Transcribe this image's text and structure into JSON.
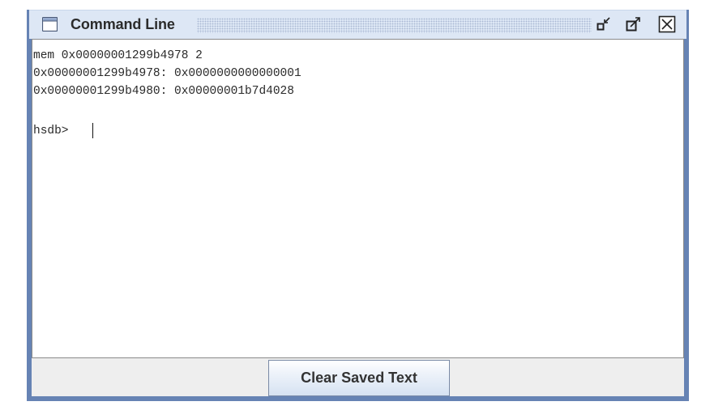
{
  "window": {
    "title": "Command Line",
    "icons": {
      "window": "terminal-window-icon",
      "iconify": "iconify-icon",
      "maximize": "maximize-icon",
      "close": "close-icon"
    }
  },
  "console": {
    "lines": [
      "mem 0x00000001299b4978 2",
      "0x00000001299b4978: 0x0000000000000001",
      "0x00000001299b4980: 0x00000001b7d4028",
      "",
      "hsdb> "
    ]
  },
  "buttons": {
    "clear_saved_text": "Clear Saved Text"
  },
  "colors": {
    "frame_border": "#6683b4",
    "titlebar": "#dde7f5",
    "console_background": "#ffffff",
    "panel_background": "#eeeeee"
  }
}
